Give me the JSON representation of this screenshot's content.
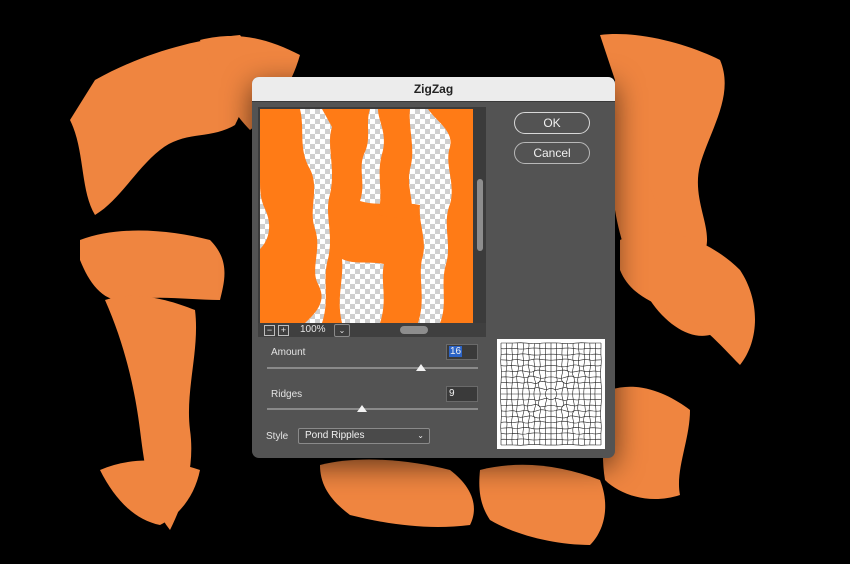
{
  "dialog": {
    "title": "ZigZag",
    "ok_label": "OK",
    "cancel_label": "Cancel",
    "zoom": {
      "minus": "−",
      "plus": "+",
      "value": "100%",
      "dropdown": "⌄"
    },
    "amount": {
      "label": "Amount",
      "value": "16",
      "level": 0.73
    },
    "ridges": {
      "label": "Ridges",
      "value": "9",
      "level": 0.45
    },
    "style": {
      "label": "Style",
      "value": "Pond Ripples"
    }
  },
  "colors": {
    "accent_orange": "#ff7b16",
    "artwork_orange": "#ef8540",
    "background": "#000000",
    "dialog_bg": "#535353"
  },
  "icons": {
    "zoom_out": "minus-icon",
    "zoom_in": "plus-icon",
    "style_chevron": "chevron-down-icon"
  }
}
